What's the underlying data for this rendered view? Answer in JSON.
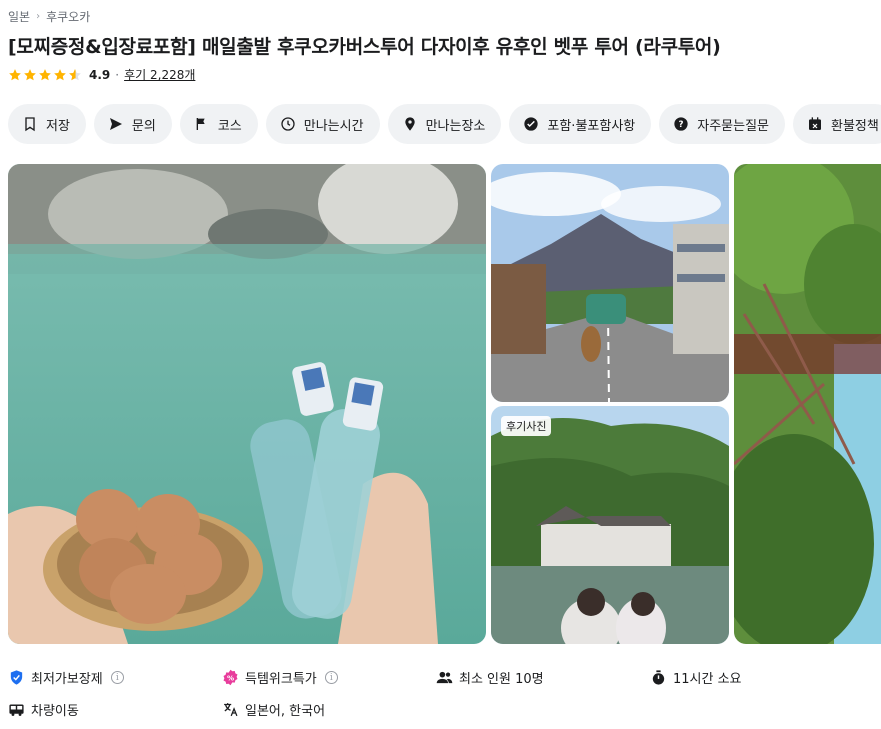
{
  "breadcrumb": {
    "country": "일본",
    "city": "후쿠오카"
  },
  "product": {
    "title": "[모찌증정&입장료포함] 매일출발 후쿠오카버스투어 다자이후 유후인 벳푸 투어 (라쿠투어)",
    "rating": "4.9",
    "rating_dot": "·",
    "reviews": "후기 2,228개",
    "stars_value": 4.9
  },
  "chips": [
    {
      "label": "저장",
      "icon": "bookmark-icon"
    },
    {
      "label": "문의",
      "icon": "send-icon"
    },
    {
      "label": "코스",
      "icon": "flag-icon"
    },
    {
      "label": "만나는시간",
      "icon": "clock-icon"
    },
    {
      "label": "만나는장소",
      "icon": "location-pin-icon"
    },
    {
      "label": "포함·불포함사항",
      "icon": "check-circle-icon"
    },
    {
      "label": "자주묻는질문",
      "icon": "question-circle-icon"
    },
    {
      "label": "환불정책",
      "icon": "calendar-x-icon"
    }
  ],
  "gallery": {
    "review_badge": "후기사진"
  },
  "features": {
    "lowest_price": "최저가보장제",
    "deal": "득템위크특가",
    "min_people": "최소 인원 10명",
    "duration": "11시간 소요",
    "transport": "차량이동",
    "language": "일본어, 한국어"
  },
  "colors": {
    "star": "#ffb400",
    "lowest_price_icon": "#1e6ff0",
    "deal_icon": "#e83d9c",
    "chip_bg": "#f0f2f4"
  }
}
